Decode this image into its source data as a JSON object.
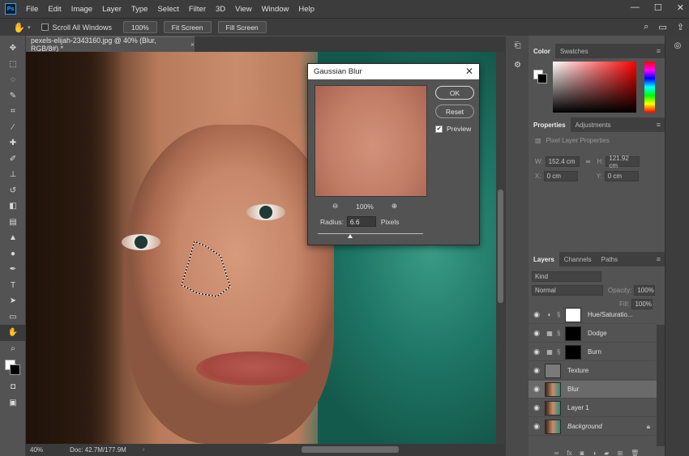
{
  "app": {
    "logo_text": "Ps"
  },
  "menu": [
    "File",
    "Edit",
    "Image",
    "Layer",
    "Type",
    "Select",
    "Filter",
    "3D",
    "View",
    "Window",
    "Help"
  ],
  "window_controls": [
    "—",
    "☐",
    "✕"
  ],
  "options_bar": {
    "scroll_all_label": "Scroll All Windows",
    "zoom_button": "100%",
    "fit_button": "Fit Screen",
    "fill_button": "Fill Screen"
  },
  "document": {
    "tab_title": "pexels-elijah-2343160.jpg @ 40% (Blur, RGB/8#) *",
    "close": "×"
  },
  "status": {
    "zoom": "40%",
    "doc_info": "Doc: 42.7M/177.9M",
    "caret": "›"
  },
  "gaussian_blur": {
    "title": "Gaussian Blur",
    "close": "✕",
    "ok_label": "OK",
    "reset_label": "Reset",
    "preview_label": "Preview",
    "preview_checked": true,
    "zoom_out": "⊖",
    "zoom_level": "100%",
    "zoom_in": "⊕",
    "radius_label": "Radius:",
    "radius_value": "6.6",
    "radius_unit": "Pixels"
  },
  "color_panel": {
    "tabs": [
      "Color",
      "Swatches"
    ],
    "menu": "≡"
  },
  "properties_panel": {
    "tabs": [
      "Properties",
      "Adjustments"
    ],
    "menu": "≡",
    "heading": "Pixel Layer Properties",
    "w_label": "W:",
    "w_value": "152.4 cm",
    "h_label": "H:",
    "h_value": "121.92 cm",
    "x_label": "X:",
    "x_value": "0 cm",
    "y_label": "Y:",
    "y_value": "0 cm",
    "link_icon": "∞"
  },
  "layers_panel": {
    "tabs": [
      "Layers",
      "Channels",
      "Paths"
    ],
    "menu": "≡",
    "kind_label": "Kind",
    "blend_mode": "Normal",
    "opacity_label": "Opacity:",
    "opacity_value": "100%",
    "fill_label": "Fill:",
    "fill_value": "100%",
    "layers": [
      {
        "name": "Hue/Saturatio...",
        "thumb": "#ffffff",
        "adjustment": true,
        "selected": false
      },
      {
        "name": "Dodge",
        "thumb": "#000000",
        "adjustment": true,
        "selected": false
      },
      {
        "name": "Burn",
        "thumb": "#000000",
        "adjustment": true,
        "selected": false
      },
      {
        "name": "Texture",
        "thumb": "#7a7a7a",
        "adjustment": false,
        "selected": false
      },
      {
        "name": "Blur",
        "thumb": "#2a6e62",
        "adjustment": false,
        "selected": true
      },
      {
        "name": "Layer 1",
        "thumb": "#2a6e62",
        "adjustment": false,
        "selected": false
      },
      {
        "name": "Background",
        "thumb": "#2a6e62",
        "adjustment": false,
        "selected": false,
        "locked": true
      }
    ],
    "footer_icons": [
      "link-icon",
      "fx-icon",
      "mask-icon",
      "adjustment-icon",
      "group-icon",
      "new-layer-icon",
      "trash-icon"
    ]
  },
  "colors": {
    "ps_blue": "#31a8ff",
    "panel_bg": "#535353",
    "selected_layer": "#6a6a6a"
  }
}
